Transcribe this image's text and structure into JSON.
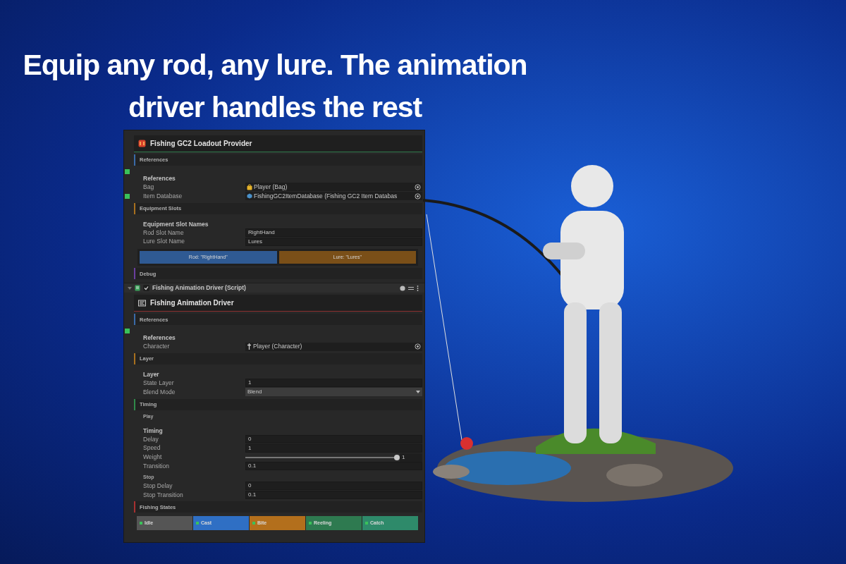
{
  "headline": [
    "Equip any rod, any lure. The animation",
    "driver handles the rest"
  ],
  "inspector": {
    "components": [
      {
        "title": "Fishing GC2 Loadout Provider",
        "color": "#2f7a4a",
        "blocks": [
          {
            "kind": "section",
            "title": "References",
            "color": "#3a6aa8"
          },
          {
            "kind": "heading",
            "text": "References",
            "marker": true
          },
          {
            "kind": "object_field",
            "label": "Bag",
            "value": "Player (Bag)",
            "marker": false
          },
          {
            "kind": "object_field",
            "label": "Item Database",
            "value": "FishingGC2ItemDatabase (Fishing GC2 Item Databas",
            "marker": true
          },
          {
            "kind": "section",
            "title": "Equipment Slots",
            "color": "#a8701e"
          },
          {
            "kind": "heading",
            "text": "Equipment Slot Names",
            "marker": false
          },
          {
            "kind": "text_field",
            "label": "Rod Slot Name",
            "value": "RightHand",
            "marker": false
          },
          {
            "kind": "text_field",
            "label": "Lure Slot Name",
            "value": "Lures",
            "marker": false
          },
          {
            "kind": "chips",
            "items": [
              {
                "label": "Rod: \"RightHand\"",
                "color": "#2f5a93"
              },
              {
                "label": "Lure: \"Lures\"",
                "color": "#7a4f18"
              }
            ]
          },
          {
            "kind": "section",
            "title": "Debug",
            "color": "#6a3fa0"
          }
        ]
      },
      {
        "header": {
          "title": "Fishing Animation Driver (Script)",
          "enabled": true
        },
        "title": "Fishing Animation Driver",
        "color": "#8a2e2e",
        "blocks": [
          {
            "kind": "section",
            "title": "References",
            "color": "#3a6aa8"
          },
          {
            "kind": "heading",
            "text": "References",
            "marker": true
          },
          {
            "kind": "object_field",
            "label": "Character",
            "value": "Player (Character)",
            "marker": false
          },
          {
            "kind": "section",
            "title": "Layer",
            "color": "#a8701e"
          },
          {
            "kind": "heading",
            "text": "Layer",
            "marker": false
          },
          {
            "kind": "text_field",
            "label": "State Layer",
            "value": "1",
            "marker": false
          },
          {
            "kind": "dropdown_field",
            "label": "Blend Mode",
            "value": "Blend",
            "marker": false
          },
          {
            "kind": "section",
            "title": "Timing",
            "color": "#2f8a4a"
          },
          {
            "kind": "subheading",
            "text": "Play"
          },
          {
            "kind": "heading",
            "text": "Timing",
            "marker": false
          },
          {
            "kind": "text_field",
            "label": "Delay",
            "value": "0",
            "marker": false
          },
          {
            "kind": "text_field",
            "label": "Speed",
            "value": "1",
            "marker": false
          },
          {
            "kind": "slider_field",
            "label": "Weight",
            "level": 1,
            "value": "1",
            "marker": false
          },
          {
            "kind": "text_field",
            "label": "Transition",
            "value": "0.1",
            "marker": false
          },
          {
            "kind": "subheading",
            "text": "Stop"
          },
          {
            "kind": "text_field",
            "label": "Stop Delay",
            "value": "0",
            "marker": false
          },
          {
            "kind": "text_field",
            "label": "Stop Transition",
            "value": "0.1",
            "marker": false
          },
          {
            "kind": "section",
            "title": "Fishing States",
            "color": "#a83030"
          },
          {
            "kind": "states",
            "items": [
              {
                "label": "Idle",
                "color": "#555555"
              },
              {
                "label": "Cast",
                "color": "#2f6fc4"
              },
              {
                "label": "Bite",
                "color": "#b36f1c"
              },
              {
                "label": "Reeling",
                "color": "#2e7a50"
              },
              {
                "label": "Catch",
                "color": "#2e8a6a"
              }
            ]
          }
        ]
      }
    ]
  }
}
